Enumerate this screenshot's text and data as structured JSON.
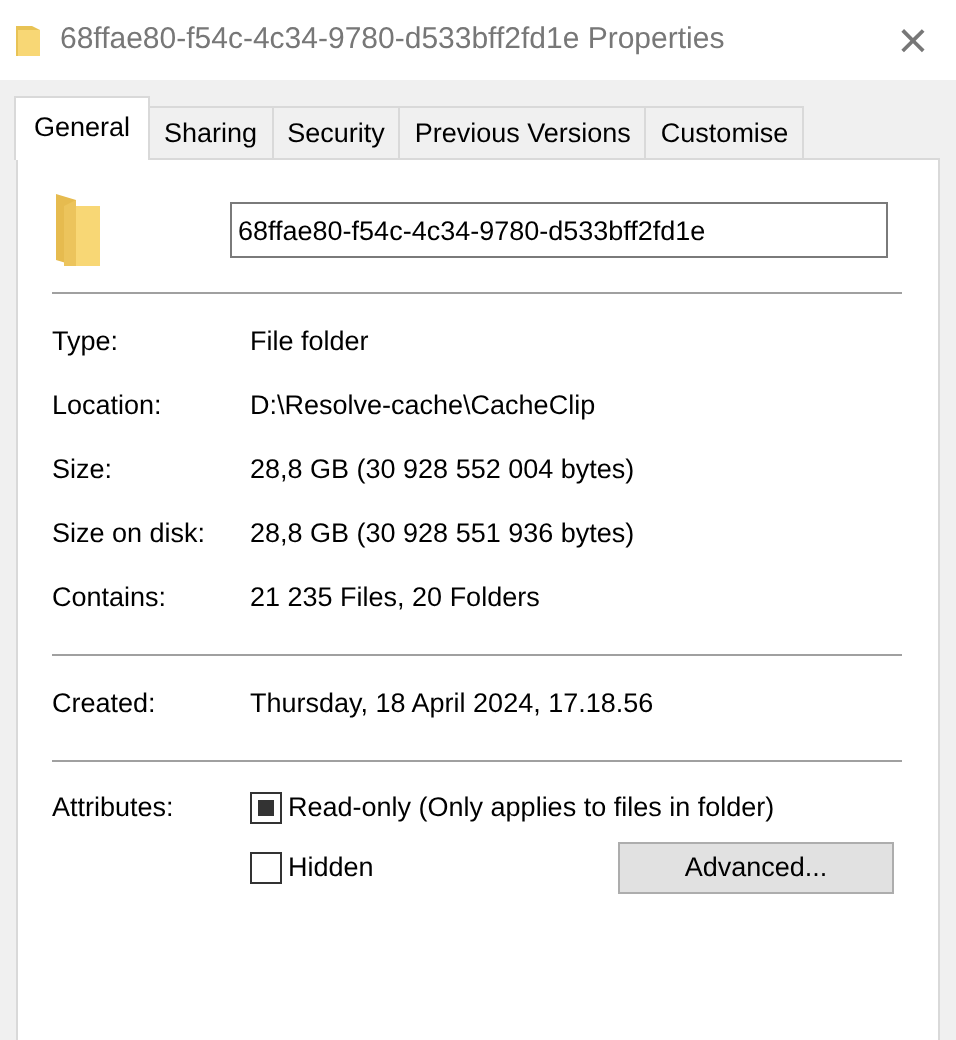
{
  "window": {
    "title": "68ffae80-f54c-4c34-9780-d533bff2fd1e Properties",
    "close": "×"
  },
  "tabs": [
    {
      "label": "General",
      "selected": true
    },
    {
      "label": "Sharing",
      "selected": false
    },
    {
      "label": "Security",
      "selected": false
    },
    {
      "label": "Previous Versions",
      "selected": false
    },
    {
      "label": "Customise",
      "selected": false
    }
  ],
  "name_field": {
    "value": "68ffae80-f54c-4c34-9780-d533bff2fd1e"
  },
  "groups": [
    [
      {
        "label": "Type:",
        "value": "File folder"
      },
      {
        "label": "Location:",
        "value": "D:\\Resolve-cache\\CacheClip"
      },
      {
        "label": "Size:",
        "value": "28,8 GB (30 928 552 004 bytes)"
      },
      {
        "label": "Size on disk:",
        "value": "28,8 GB (30 928 551 936 bytes)"
      },
      {
        "label": "Contains:",
        "value": "21 235 Files, 20 Folders"
      }
    ],
    [
      {
        "label": "Created:",
        "value": "Thursday, 18 April 2024, 17.18.56"
      }
    ]
  ],
  "attributes": {
    "label": "Attributes:",
    "options": [
      {
        "label": "Read-only (Only applies to files in folder)",
        "checked": false,
        "indeterminate": true
      },
      {
        "label": "Hidden",
        "checked": false,
        "indeterminate": false
      }
    ],
    "button": "Advanced..."
  }
}
